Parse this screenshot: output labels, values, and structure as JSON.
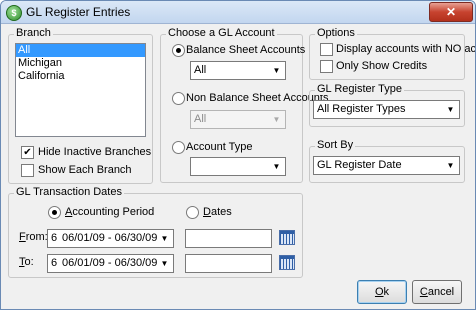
{
  "window": {
    "title": "GL Register Entries",
    "close_label": "✕"
  },
  "branch": {
    "label": "Branch",
    "items": [
      {
        "label": "All",
        "selected": true
      },
      {
        "label": "Michigan",
        "selected": false
      },
      {
        "label": "California",
        "selected": false
      }
    ],
    "hide_inactive": {
      "label": "Hide Inactive Branches",
      "checked": true
    },
    "show_each": {
      "label": "Show Each Branch",
      "checked": false
    }
  },
  "gl_account": {
    "label": "Choose a GL Account",
    "balance_sheet": {
      "label": "Balance Sheet Accounts",
      "selected": true,
      "value": "All"
    },
    "non_balance_sheet": {
      "label": "Non Balance Sheet Accounts",
      "selected": false,
      "value": "All"
    },
    "account_type": {
      "label": "Account Type",
      "selected": false,
      "value": ""
    }
  },
  "options": {
    "label": "Options",
    "display_no_activity": {
      "label": "Display accounts with NO activity",
      "checked": false
    },
    "only_credits": {
      "label": "Only Show Credits",
      "checked": false
    }
  },
  "register_type": {
    "label": "GL Register Type",
    "value": "All Register Types"
  },
  "sort_by": {
    "label": "Sort By",
    "value": "GL Register Date"
  },
  "transaction_dates": {
    "label": "GL Transaction Dates",
    "accounting_period": {
      "label_prefix": "",
      "label_hotkey": "A",
      "label_rest": "ccounting Period",
      "selected": true
    },
    "dates": {
      "label_hotkey": "D",
      "label_rest": "ates",
      "selected": false
    },
    "from": {
      "label_hotkey": "F",
      "label_rest": "rom:",
      "period_num": "6",
      "period_range": "06/01/09 - 06/30/09",
      "date_value": ""
    },
    "to": {
      "label_hotkey": "T",
      "label_rest": "o:",
      "period_num": "6",
      "period_range": "06/01/09 - 06/30/09",
      "date_value": ""
    }
  },
  "buttons": {
    "ok": {
      "hotkey": "O",
      "rest": "k"
    },
    "cancel": {
      "hotkey": "C",
      "rest": "ancel"
    }
  }
}
